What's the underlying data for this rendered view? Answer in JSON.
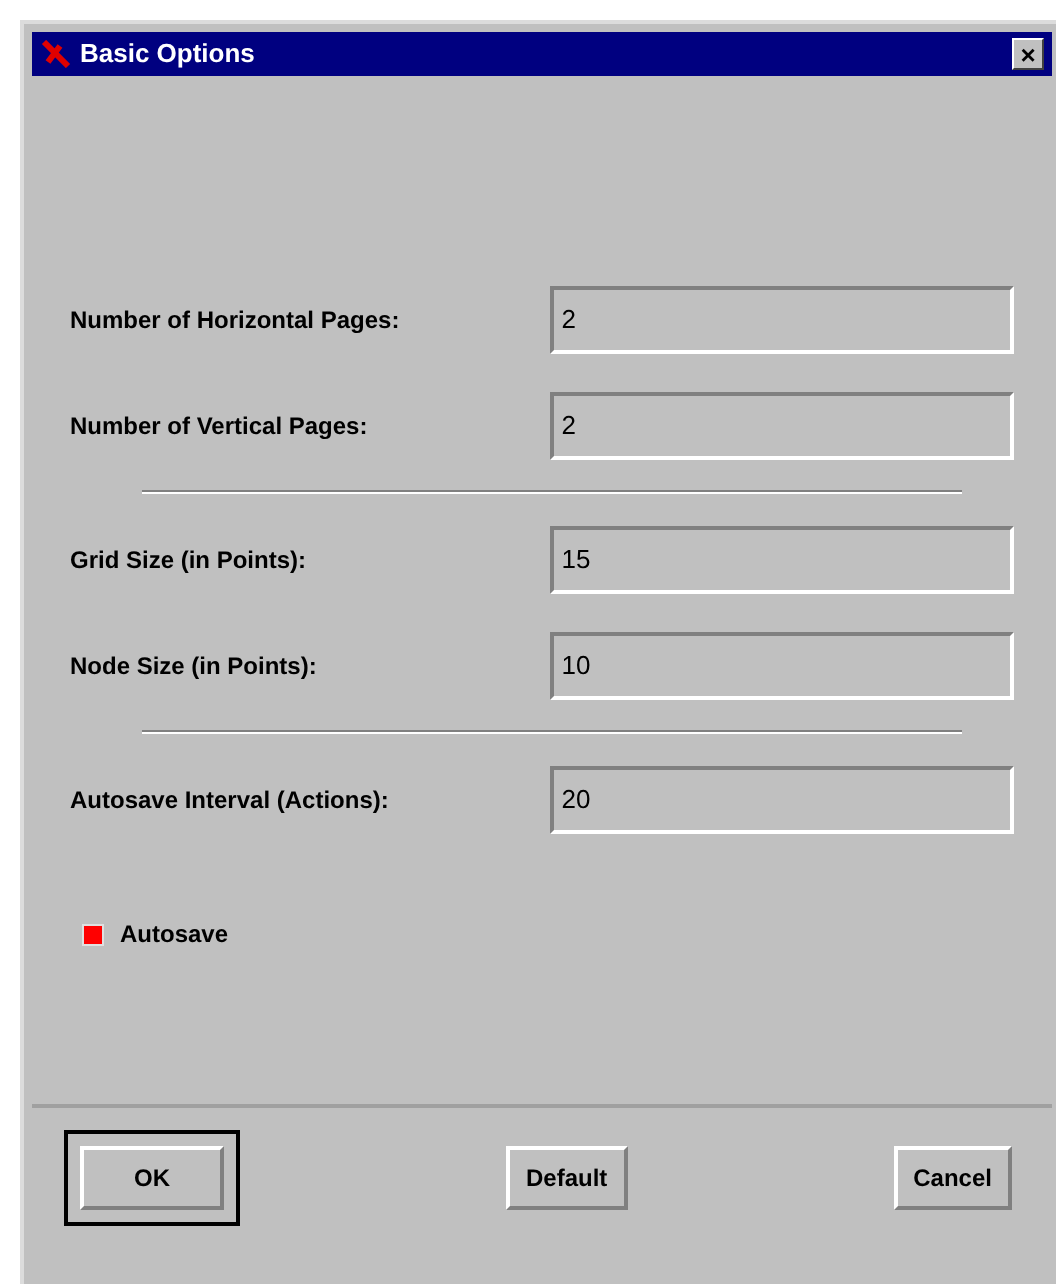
{
  "window": {
    "title": "Basic Options",
    "close": "×"
  },
  "rows": [
    {
      "kind": "field",
      "label": "Number of Horizontal Pages:",
      "value": "2"
    },
    {
      "kind": "field",
      "label": "Number of Vertical Pages:",
      "value": "2"
    },
    {
      "kind": "separator"
    },
    {
      "kind": "field",
      "label": "Grid Size (in Points):",
      "value": "15"
    },
    {
      "kind": "field",
      "label": "Node Size (in Points):",
      "value": "10"
    },
    {
      "kind": "separator"
    },
    {
      "kind": "field",
      "label": "Autosave Interval (Actions):",
      "value": "20"
    },
    {
      "kind": "checkbox",
      "label": "Autosave",
      "checked": true
    }
  ],
  "buttons": [
    {
      "label": "OK",
      "default": true
    },
    {
      "label": "Default",
      "default": false
    },
    {
      "label": "Cancel",
      "default": false
    }
  ]
}
